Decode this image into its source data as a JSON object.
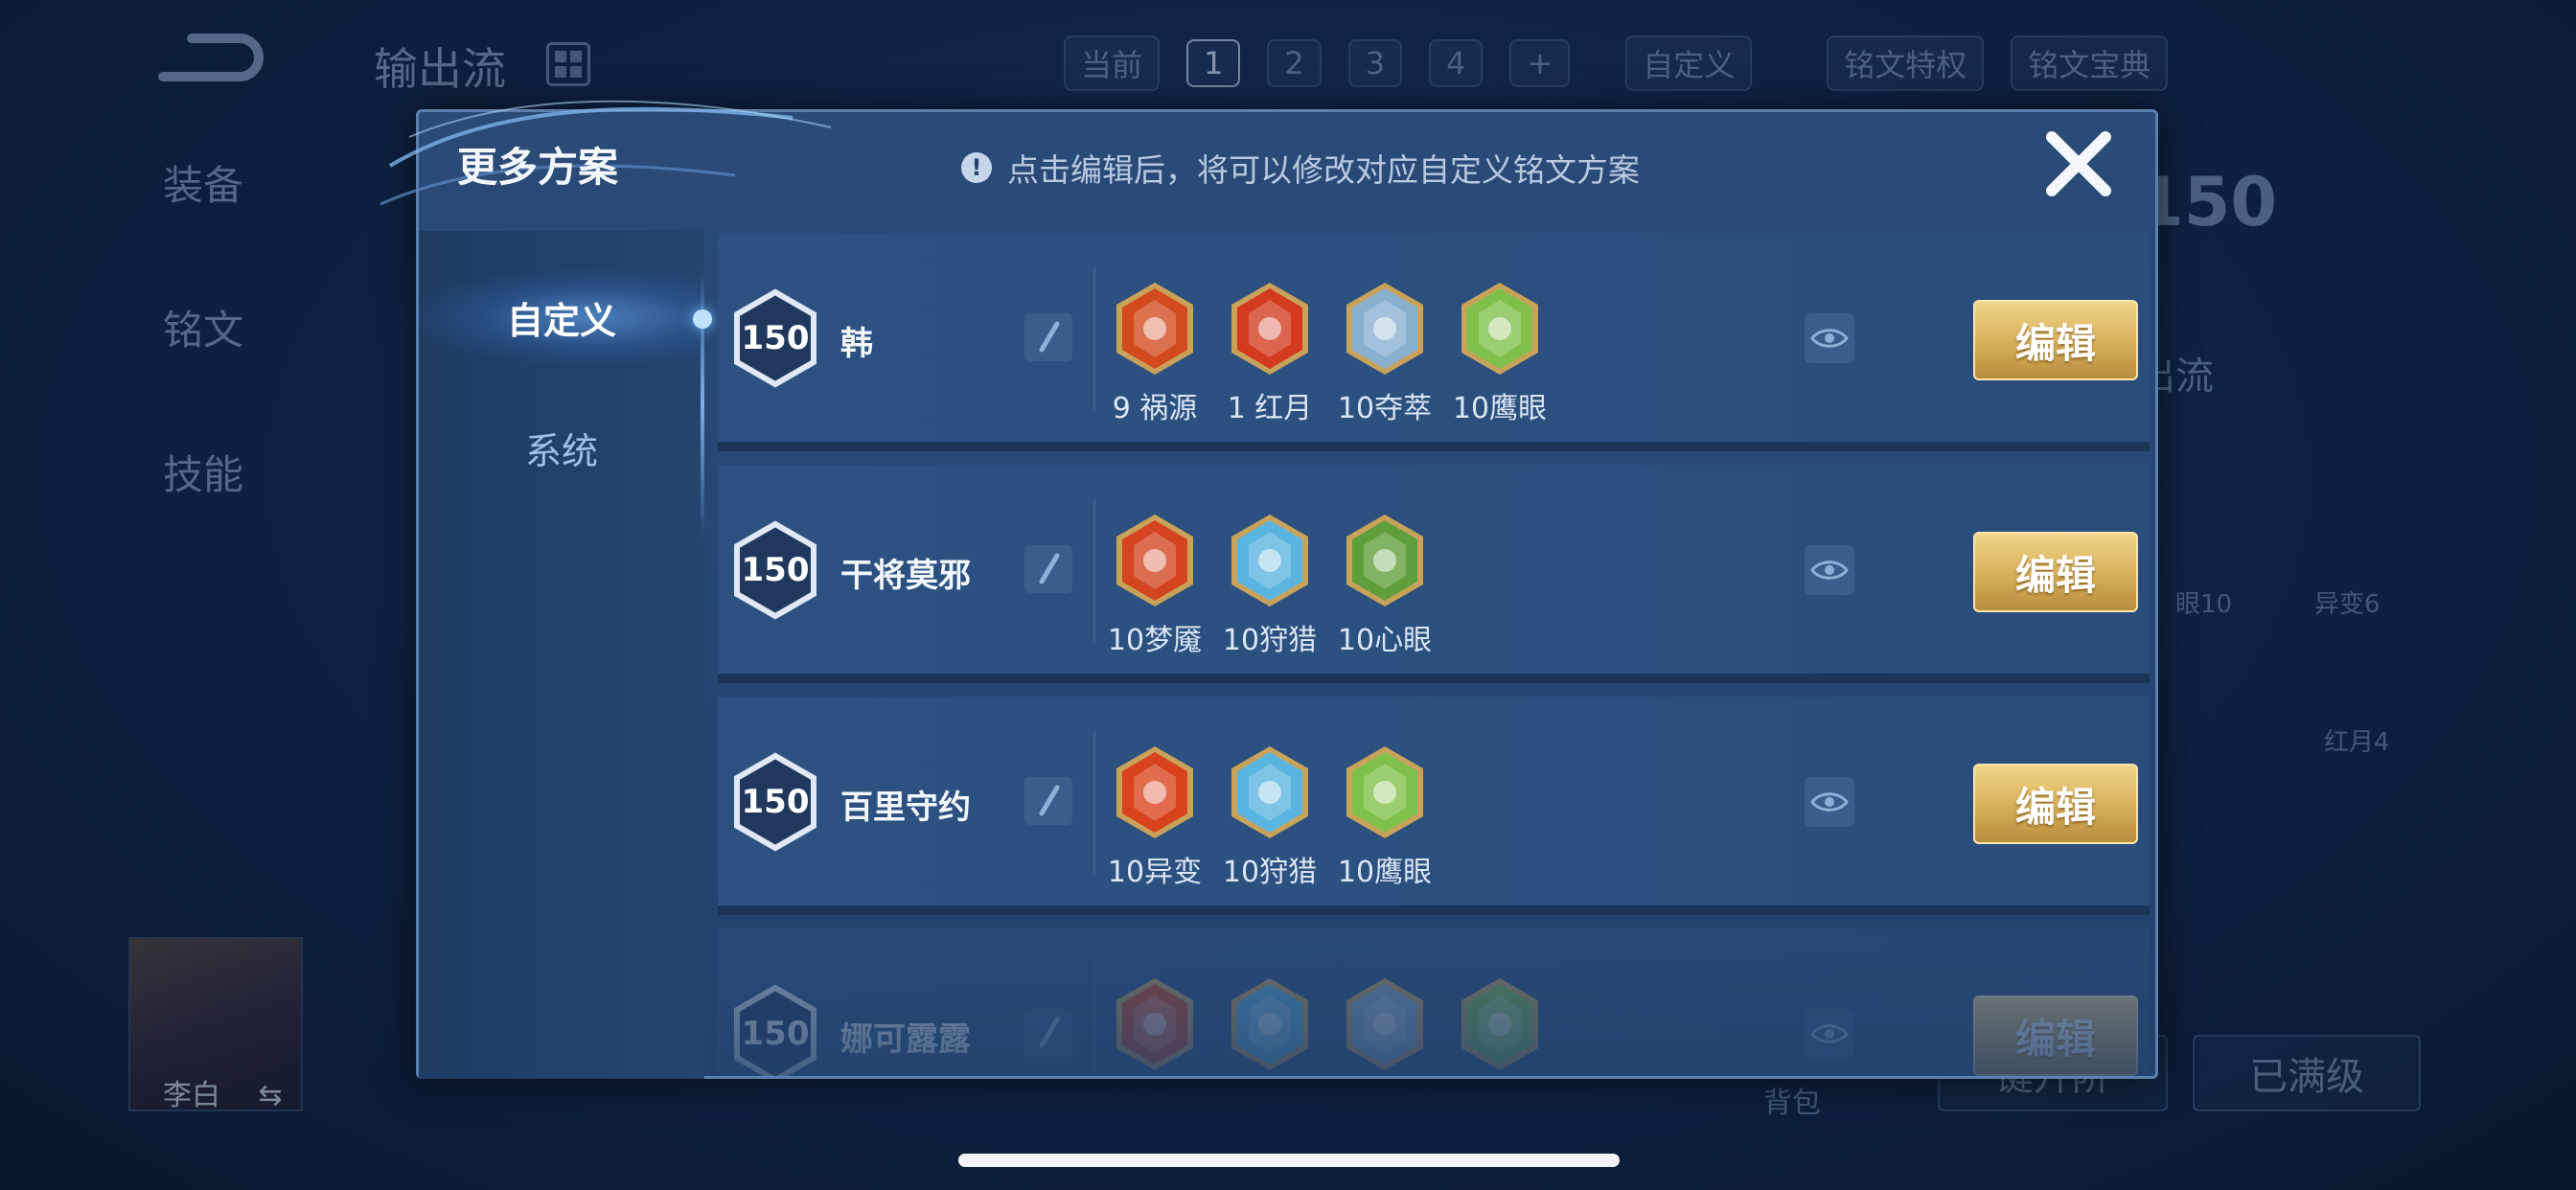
{
  "background": {
    "title": "输出流",
    "topbar": {
      "current_label": "当前",
      "pages": [
        "1",
        "2",
        "3",
        "4"
      ],
      "active_page": "1",
      "add": "+",
      "custom": "自定义",
      "privilege": "铭文特权",
      "codex": "铭文宝典"
    },
    "side_nav": [
      "装备",
      "铭文",
      "技能"
    ],
    "avatar_name": "李白",
    "swap_icon": "⇆",
    "right_level": "150",
    "right_flow": "出流",
    "bag": "背包",
    "btn_upgrade": "键升阶",
    "btn_full": "已满级",
    "rune_labels": [
      "眼10",
      "异变6",
      "红月4"
    ]
  },
  "modal": {
    "title": "更多方案",
    "notice": "点击编辑后，将可以修改对应自定义铭文方案",
    "notice_icon": "!",
    "tabs": [
      {
        "label": "自定义",
        "active": true
      },
      {
        "label": "系统",
        "active": false
      }
    ],
    "edit_label": "编辑",
    "plans": [
      {
        "level": "150",
        "hero": "韩",
        "runes": [
          {
            "label": "9 祸源",
            "icon": "rune-huoyuan-icon",
            "color": "#d24a1e"
          },
          {
            "label": "1 红月",
            "icon": "rune-hongyue-icon",
            "color": "#d33a1e"
          },
          {
            "label": "10夺萃",
            "icon": "rune-duocui-icon",
            "color": "#8ab0d0"
          },
          {
            "label": "10鹰眼",
            "icon": "rune-yingyan-icon",
            "color": "#7fc04a"
          }
        ]
      },
      {
        "level": "150",
        "hero": "干将莫邪",
        "runes": [
          {
            "label": "10梦魇",
            "icon": "rune-mengyan-icon",
            "color": "#d44420"
          },
          {
            "label": "10狩猎",
            "icon": "rune-shoulie-icon",
            "color": "#5ab4e0"
          },
          {
            "label": "10心眼",
            "icon": "rune-xinyan-icon",
            "color": "#5f9e3a"
          }
        ]
      },
      {
        "level": "150",
        "hero": "百里守约",
        "runes": [
          {
            "label": "10异变",
            "icon": "rune-yibian-icon",
            "color": "#d8421c"
          },
          {
            "label": "10狩猎",
            "icon": "rune-shoulie-icon",
            "color": "#5ab4e0"
          },
          {
            "label": "10鹰眼",
            "icon": "rune-yingyan-icon",
            "color": "#7fc04a"
          }
        ]
      },
      {
        "level": "150",
        "hero": "娜可露露",
        "runes": [
          {
            "label": "",
            "icon": "rune-yibian-icon",
            "color": "#d8421c"
          },
          {
            "label": "",
            "icon": "rune-shoulie-icon",
            "color": "#5ab4e0"
          },
          {
            "label": "",
            "icon": "rune-duocui-icon",
            "color": "#8ab0d0"
          },
          {
            "label": "",
            "icon": "rune-yingyan-icon",
            "color": "#7fc04a"
          }
        ]
      }
    ]
  }
}
